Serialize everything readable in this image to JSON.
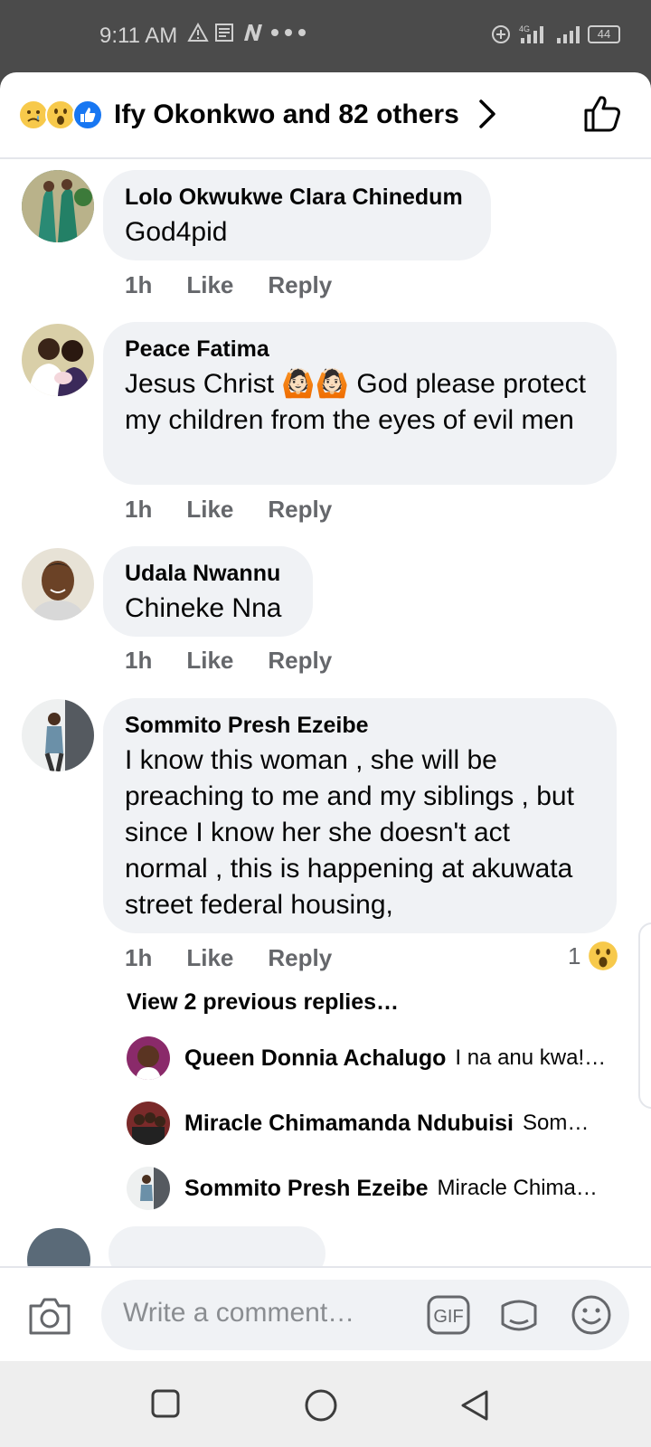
{
  "status": {
    "time": "9:11 AM",
    "battery": "44",
    "network": "4G"
  },
  "reactions": {
    "emoji_names": [
      "sad-emoji",
      "wow-emoji",
      "like-emoji"
    ],
    "summary": "Ify Okonkwo and 82 others"
  },
  "comments": [
    {
      "name": "Lolo Okwukwe Clara Chinedum",
      "text": "God4pid",
      "time": "1h",
      "like": "Like",
      "reply": "Reply"
    },
    {
      "name": "Peace Fatima",
      "text": "Jesus Christ 🙆🏻🙆🏻 God please protect my children from the eyes of evil men",
      "time": "1h",
      "like": "Like",
      "reply": "Reply"
    },
    {
      "name": "Udala Nwannu",
      "text": "Chineke Nna",
      "time": "1h",
      "like": "Like",
      "reply": "Reply"
    },
    {
      "name": "Sommito Presh Ezeibe",
      "text": "I know this woman , she will be preaching to me and my siblings , but since I know her she doesn't act normal , this is happening at akuwata street  federal housing,",
      "time": "1h",
      "like": "Like",
      "reply": "Reply",
      "reaction_count": "1",
      "reaction_emoji": "wow-emoji",
      "view_previous": "View 2 previous replies…",
      "replies": [
        {
          "name": "Queen Donnia Achalugo",
          "text": "I na anu kwa!…"
        },
        {
          "name": "Miracle Chimamanda Ndubuisi",
          "text": "Som…"
        },
        {
          "name": "Sommito Presh Ezeibe",
          "text": "Miracle Chima…"
        }
      ]
    }
  ],
  "composer": {
    "placeholder": "Write a comment…",
    "gif_label": "GIF"
  },
  "colors": {
    "bubble": "#f0f2f5",
    "meta_text": "#65676b",
    "like_blue": "#1877f2",
    "emoji_yellow": "#f7c94b"
  }
}
